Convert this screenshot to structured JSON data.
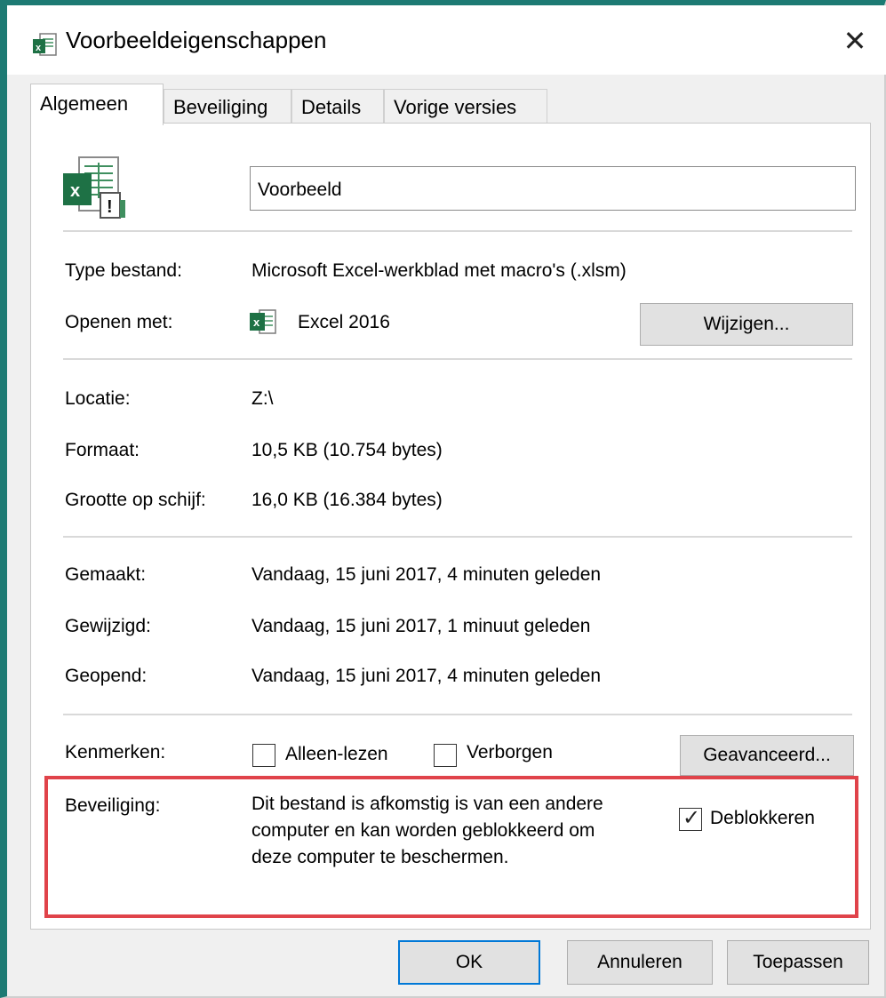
{
  "window": {
    "title": "Voorbeeldeigenschappen",
    "close_glyph": "✕"
  },
  "tabs": [
    {
      "label": "Algemeen",
      "active": true
    },
    {
      "label": "Beveiliging",
      "active": false
    },
    {
      "label": "Details",
      "active": false
    },
    {
      "label": "Vorige versies",
      "active": false
    }
  ],
  "general": {
    "file_name": "Voorbeeld",
    "type_label": "Type bestand:",
    "type_value": "Microsoft Excel-werkblad met macro's (.xlsm)",
    "opens_with_label": "Openen met:",
    "opens_with_value": "Excel 2016",
    "change_button": "Wijzigen...",
    "location_label": "Locatie:",
    "location_value": "Z:\\",
    "size_label": "Formaat:",
    "size_value": "10,5 KB (10.754 bytes)",
    "disk_size_label": "Grootte op schijf:",
    "disk_size_value": "16,0 KB (16.384 bytes)",
    "created_label": "Gemaakt:",
    "created_value": "Vandaag, 15 juni 2017, 4 minuten geleden",
    "modified_label": "Gewijzigd:",
    "modified_value": "Vandaag, 15 juni 2017, 1 minuut geleden",
    "accessed_label": "Geopend:",
    "accessed_value": "Vandaag, 15 juni 2017, 4 minuten geleden",
    "attributes_label": "Kenmerken:",
    "readonly_label": "Alleen-lezen",
    "readonly_checked": false,
    "hidden_label": "Verborgen",
    "hidden_checked": false,
    "advanced_button": "Geavanceerd...",
    "security_label": "Beveiliging:",
    "security_line1": "Dit bestand is afkomstig is van een andere",
    "security_line2": "computer en kan worden geblokkeerd om",
    "security_line3": "deze computer te beschermen.",
    "unblock_label": "Deblokkeren",
    "unblock_checked": true,
    "checkmark_glyph": "✓"
  },
  "footer": {
    "ok": "OK",
    "cancel": "Annuleren",
    "apply": "Toepassen"
  },
  "colors": {
    "excel_green": "#1e7145",
    "highlight_red": "#e0434a",
    "window_accent": "#1d7a73"
  },
  "icons": {
    "title_icon": "excel-file-icon",
    "large_icon": "excel-macro-file-icon",
    "app_icon": "excel-app-icon"
  }
}
